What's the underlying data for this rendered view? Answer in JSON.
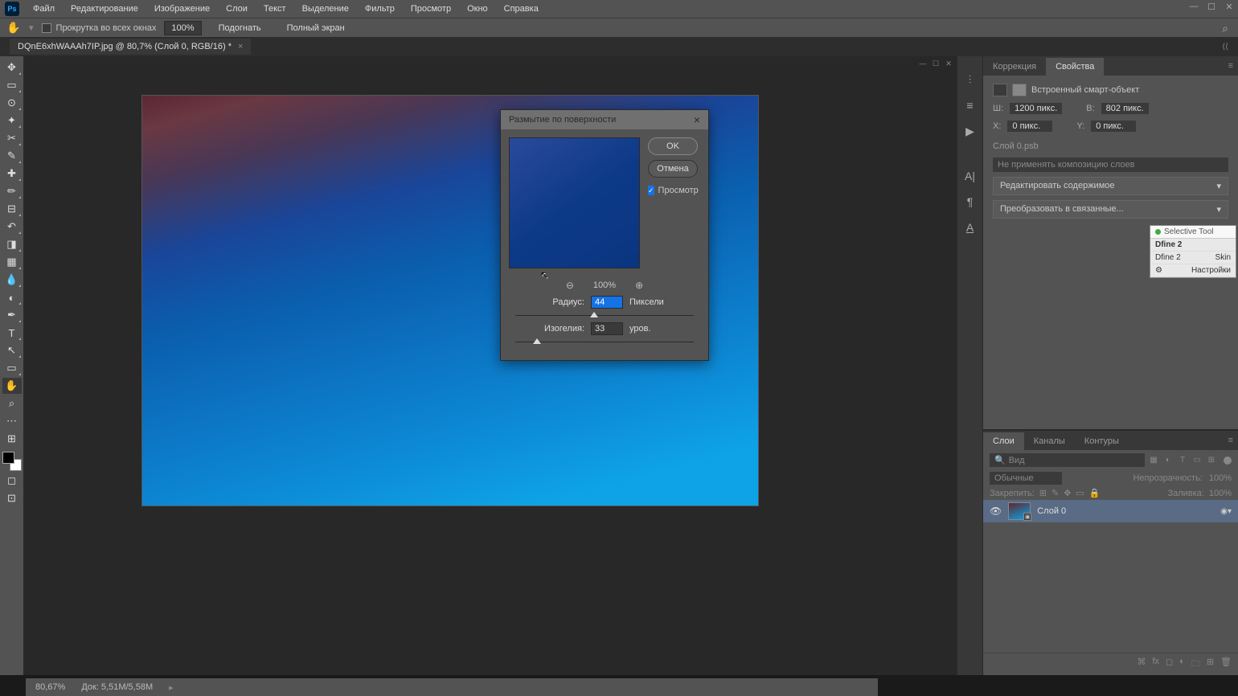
{
  "menubar": {
    "items": [
      "Файл",
      "Редактирование",
      "Изображение",
      "Слои",
      "Текст",
      "Выделение",
      "Фильтр",
      "Просмотр",
      "Окно",
      "Справка"
    ]
  },
  "optionsbar": {
    "scroll_all_label": "Прокрутка во всех окнах",
    "zoom_display": "100%",
    "fit_btn": "Подогнать",
    "fullscreen_btn": "Полный экран"
  },
  "document": {
    "tab_title": "DQnE6xhWAAAh7IP.jpg @ 80,7% (Слой 0, RGB/16) *"
  },
  "dialog": {
    "title": "Размытие по поверхности",
    "ok": "OK",
    "cancel": "Отмена",
    "preview": "Просмотр",
    "zoom_pct": "100%",
    "radius_label": "Радиус:",
    "radius_value": "44",
    "radius_unit": "Пиксели",
    "isohelia_label": "Изогелия:",
    "isohelia_value": "33",
    "isohelia_unit": "уров."
  },
  "panels": {
    "correction_tab": "Коррекция",
    "properties_tab": "Свойства",
    "smart_object_label": "Встроенный смарт-объект",
    "w_label": "Ш:",
    "w_value": "1200 пикс.",
    "h_label": "В:",
    "h_value": "802 пикс.",
    "x_label": "X:",
    "x_value": "0 пикс.",
    "y_label": "Y:",
    "y_value": "0 пикс.",
    "layer_file": "Слой 0.psb",
    "no_comp": "Не применять композицию слоев",
    "edit_contents": "Редактировать содержимое",
    "convert_linked": "Преобразовать в связанные..."
  },
  "mini_panel": {
    "selective_tool": "Selective Tool",
    "dfine2": "Dfine 2",
    "dfine_row": "Dfine 2",
    "skin": "Skin",
    "settings": "Настройки"
  },
  "layers": {
    "tab_layers": "Слои",
    "tab_channels": "Каналы",
    "tab_paths": "Контуры",
    "search_placeholder": "Вид",
    "blend_mode": "Обычные",
    "opacity_label": "Непрозрачность:",
    "opacity_value": "100%",
    "lock_label": "Закрепить:",
    "fill_label": "Заливка:",
    "fill_value": "100%",
    "layer0_name": "Слой 0"
  },
  "statusbar": {
    "zoom": "80,67%",
    "docsize": "Док: 5,51M/5,58M"
  }
}
